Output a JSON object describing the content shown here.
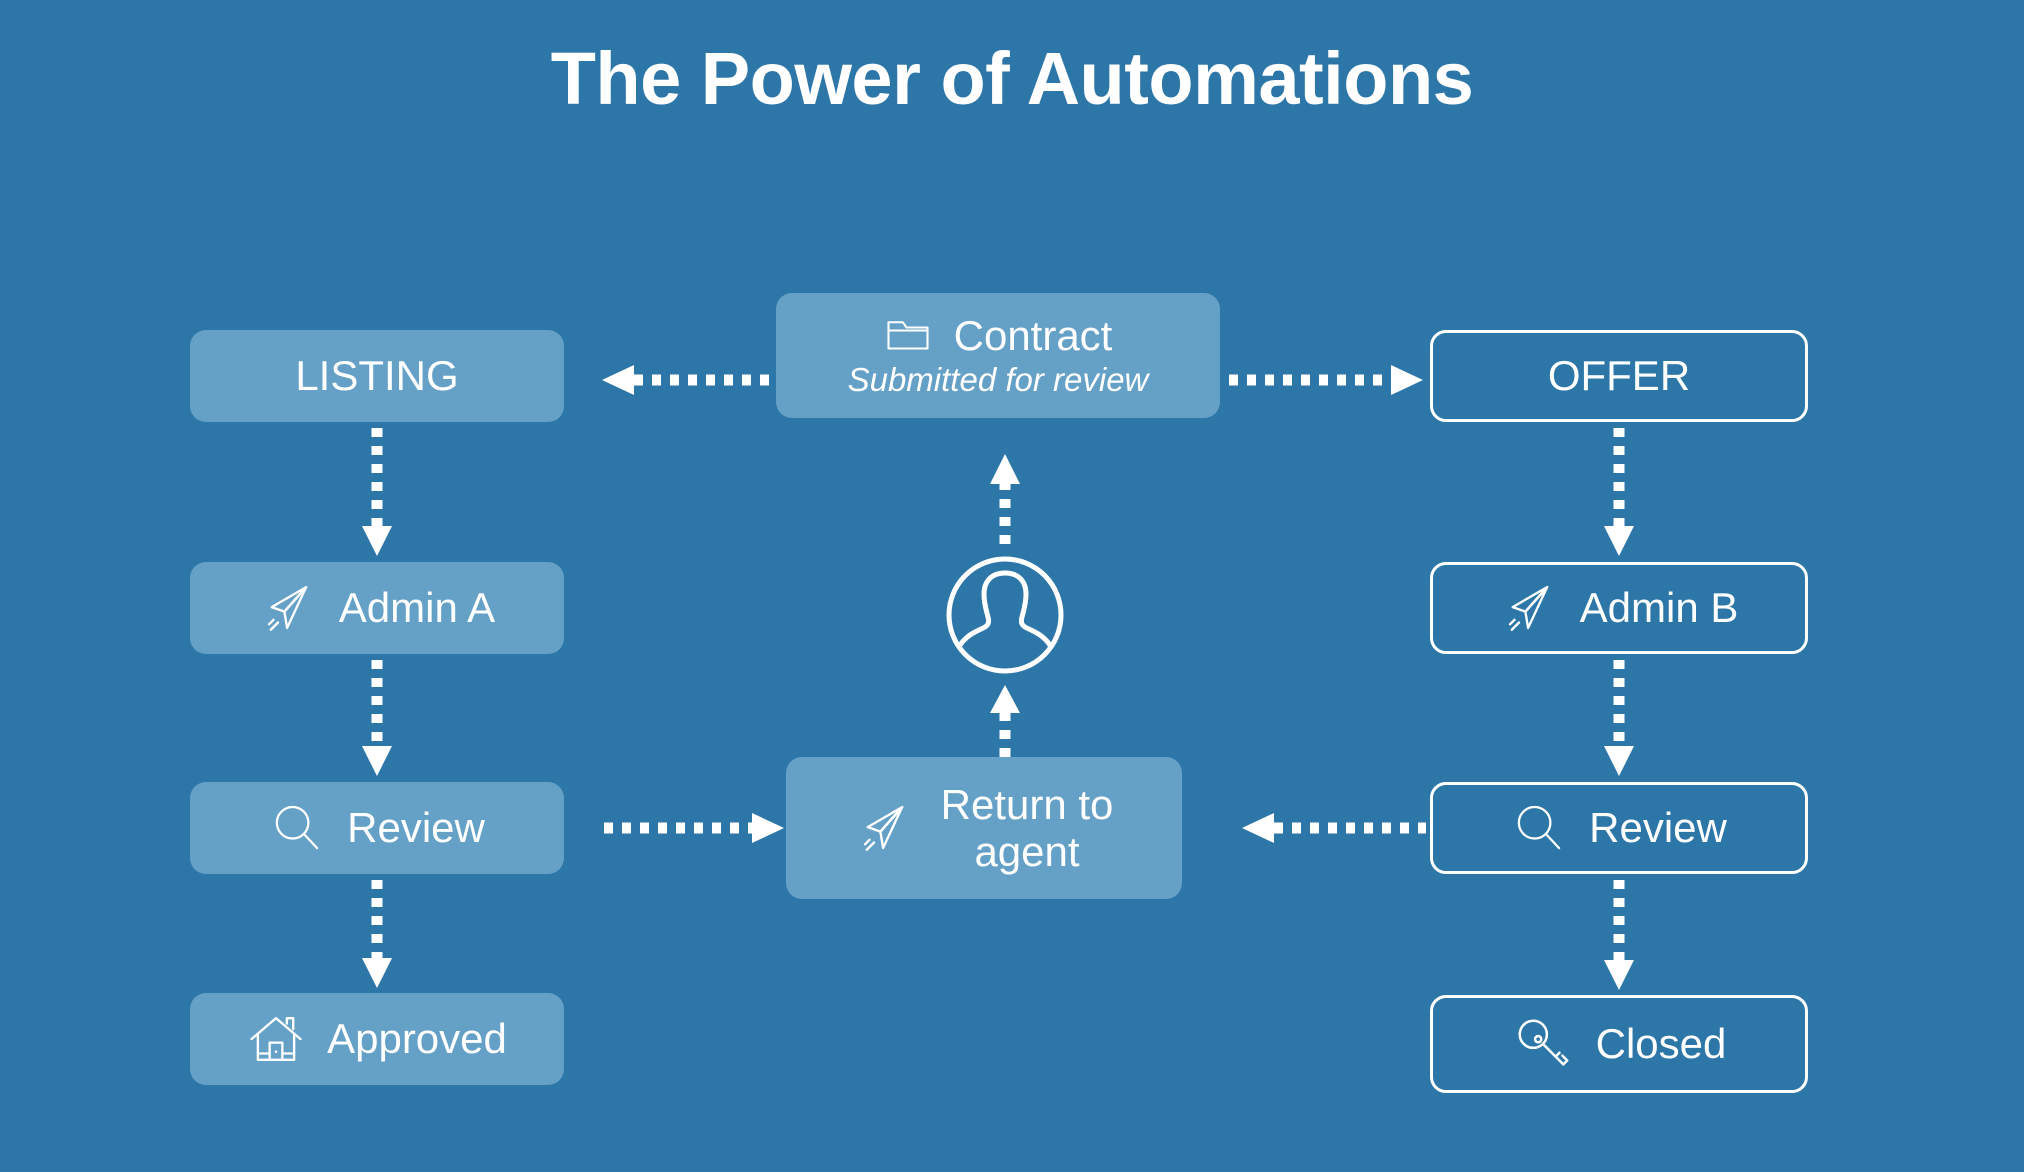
{
  "title": "The Power of Automations",
  "colors": {
    "background": "#2d76a8",
    "filled_box": "#65a0c6",
    "stroke": "#ffffff",
    "text": "#ffffff"
  },
  "nodes": {
    "listing": {
      "label": "LISTING",
      "style": "filled",
      "icon": "none"
    },
    "admin_a": {
      "label": "Admin A",
      "style": "filled",
      "icon": "paper-plane-icon"
    },
    "review_left": {
      "label": "Review",
      "style": "filled",
      "icon": "magnifier-icon"
    },
    "approved": {
      "label": "Approved",
      "style": "filled",
      "icon": "house-icon"
    },
    "contract": {
      "label": "Contract",
      "sublabel": "Submitted for review",
      "style": "filled",
      "icon": "folder-icon"
    },
    "return_agent": {
      "label": "Return to\nagent",
      "style": "filled",
      "icon": "paper-plane-icon"
    },
    "avatar": {
      "label": "",
      "style": "icon-only",
      "icon": "user-circle-icon"
    },
    "offer": {
      "label": "OFFER",
      "style": "outlined",
      "icon": "none"
    },
    "admin_b": {
      "label": "Admin B",
      "style": "outlined",
      "icon": "paper-plane-icon"
    },
    "review_right": {
      "label": "Review",
      "style": "outlined",
      "icon": "magnifier-icon"
    },
    "closed": {
      "label": "Closed",
      "style": "outlined",
      "icon": "key-icon"
    }
  },
  "arrows": [
    {
      "name": "contract-to-listing",
      "direction": "left"
    },
    {
      "name": "contract-to-offer",
      "direction": "right"
    },
    {
      "name": "listing-to-admin-a",
      "direction": "down"
    },
    {
      "name": "admin-a-to-review-left",
      "direction": "down"
    },
    {
      "name": "review-left-to-approved",
      "direction": "down"
    },
    {
      "name": "offer-to-admin-b",
      "direction": "down"
    },
    {
      "name": "admin-b-to-review-right",
      "direction": "down"
    },
    {
      "name": "review-right-to-closed",
      "direction": "down"
    },
    {
      "name": "review-left-to-return",
      "direction": "right"
    },
    {
      "name": "review-right-to-return",
      "direction": "left"
    },
    {
      "name": "return-to-avatar",
      "direction": "up"
    },
    {
      "name": "avatar-to-contract",
      "direction": "up"
    }
  ]
}
